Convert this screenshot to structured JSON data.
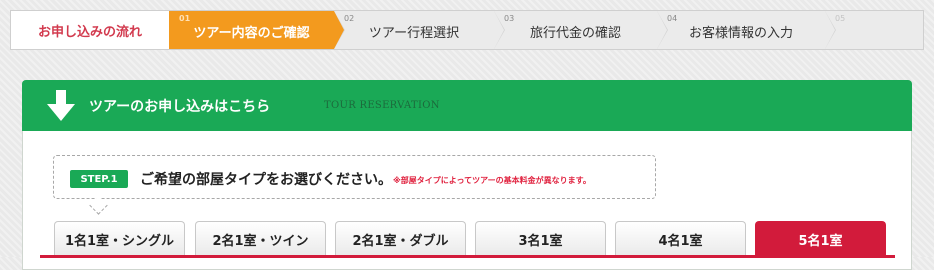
{
  "progress": {
    "flow_title": "お申し込みの流れ",
    "steps": [
      {
        "num": "01",
        "label": "ツアー内容のご確認",
        "active": true
      },
      {
        "num": "02",
        "label": "ツアー行程選択",
        "active": false
      },
      {
        "num": "03",
        "label": "旅行代金の確認",
        "active": false
      },
      {
        "num": "04",
        "label": "お客様情報の入力",
        "active": false
      },
      {
        "num": "05",
        "label": "",
        "active": false
      }
    ]
  },
  "panel": {
    "title": "ツアーのお申し込みはこちら",
    "subtitle": "TOUR RESERVATION",
    "callout": {
      "badge": "STEP.1",
      "main": "ご希望の部屋タイプをお選びください。",
      "note": "※部屋タイプによってツアーの基本料金が異なります。"
    },
    "tabs": [
      {
        "label": "1名1室・シングル",
        "active": false
      },
      {
        "label": "2名1室・ツイン",
        "active": false
      },
      {
        "label": "2名1室・ダブル",
        "active": false
      },
      {
        "label": "3名1室",
        "active": false
      },
      {
        "label": "4名1室",
        "active": false
      },
      {
        "label": "5名1室",
        "active": true
      }
    ]
  },
  "colors": {
    "progress_active": "#f39a1e",
    "flow_title": "#d23a4e",
    "panel_green": "#1aa956",
    "tab_active": "#d21b3b",
    "note_red": "#e0223f"
  }
}
